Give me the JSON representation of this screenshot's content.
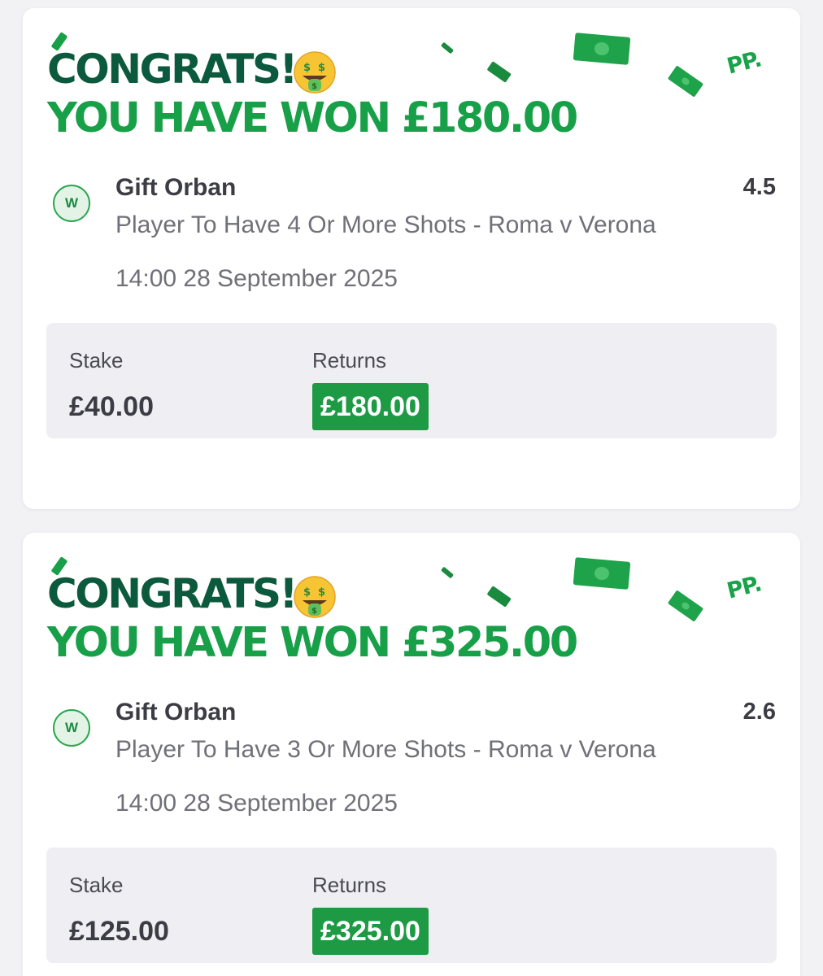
{
  "bets": [
    {
      "congrats_title": "CONGRATS!",
      "won_text": "YOU HAVE WON £180.00",
      "emoji_icon": "money-mouth-face-icon",
      "brand_mark": "PP.",
      "result_badge": "W",
      "player": "Gift Orban",
      "odds": "4.5",
      "market": "Player To Have 4 Or More Shots - Roma v Verona",
      "datetime": "14:00 28 September 2025",
      "stake_label": "Stake",
      "stake_value": "£40.00",
      "returns_label": "Returns",
      "returns_value": "£180.00"
    },
    {
      "congrats_title": "CONGRATS!",
      "won_text": "YOU HAVE WON £325.00",
      "emoji_icon": "money-mouth-face-icon",
      "brand_mark": "PP.",
      "result_badge": "W",
      "player": "Gift Orban",
      "odds": "2.6",
      "market": "Player To Have 3 Or More Shots - Roma v Verona",
      "datetime": "14:00 28 September 2025",
      "stake_label": "Stake",
      "stake_value": "£125.00",
      "returns_label": "Returns",
      "returns_value": "£325.00"
    }
  ],
  "colors": {
    "dark_green": "#0c5a3d",
    "brand_green": "#17a048",
    "returns_green": "#1e9a45",
    "summary_bg": "#efeff3"
  }
}
